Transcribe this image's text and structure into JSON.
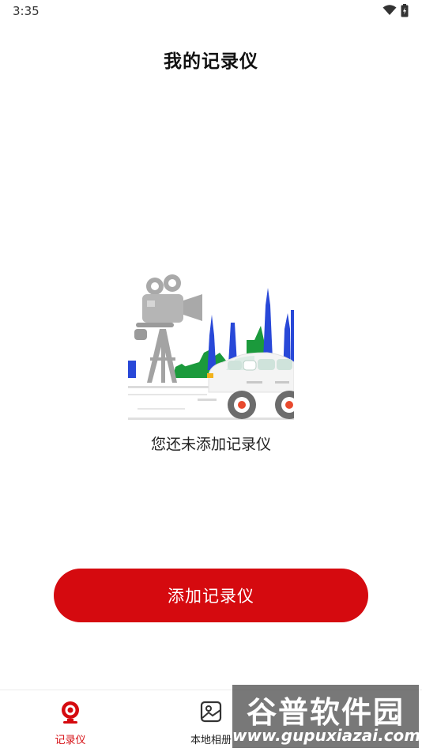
{
  "status_bar": {
    "time": "3:35",
    "wifi_icon": "wifi-icon",
    "battery_icon": "battery-charging-icon"
  },
  "header": {
    "title": "我的记录仪"
  },
  "empty_state": {
    "illustration": "dashcam-illustration",
    "message": "您还未添加记录仪"
  },
  "actions": {
    "add_label": "添加记录仪",
    "accent_color": "#d50a0f"
  },
  "bottom_nav": {
    "items": [
      {
        "label": "记录仪",
        "icon": "recorder-icon",
        "active": true
      },
      {
        "label": "本地相册",
        "icon": "album-icon",
        "active": false
      }
    ]
  },
  "watermark": {
    "title": "谷普软件园",
    "url": "www.gupuxiazai.com"
  }
}
